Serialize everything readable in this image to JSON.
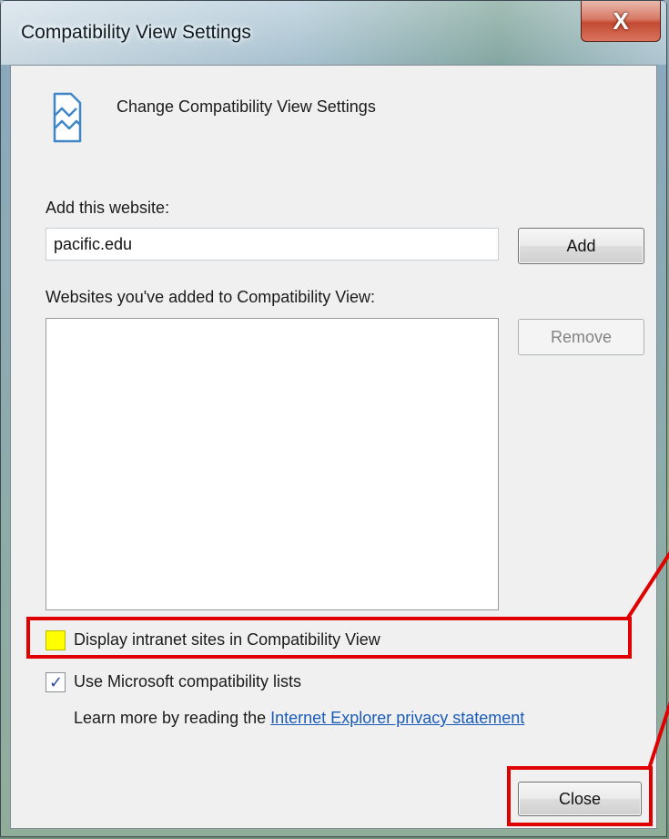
{
  "window": {
    "title": "Compatibility View Settings",
    "close_glyph": "X"
  },
  "header": {
    "icon": "compatibility-view-icon",
    "title": "Change Compatibility View Settings"
  },
  "add_website": {
    "label": "Add this website:",
    "value": "pacific.edu",
    "add_button_label": "Add"
  },
  "added_list": {
    "label": "Websites you've added to Compatibility View:",
    "items": [],
    "remove_button_label": "Remove"
  },
  "options": {
    "intranet": {
      "label": "Display intranet sites in Compatibility View",
      "checked": false
    },
    "ms_lists": {
      "label": "Use Microsoft compatibility lists",
      "checked": true,
      "check_glyph": "✓"
    }
  },
  "privacy": {
    "prefix": "Learn more by reading the ",
    "link_text": "Internet Explorer privacy statement"
  },
  "footer": {
    "close_button_label": "Close"
  },
  "colors": {
    "annotation_red": "#e00000",
    "highlight_yellow": "#ffff00",
    "link_blue": "#1a5cb8"
  }
}
